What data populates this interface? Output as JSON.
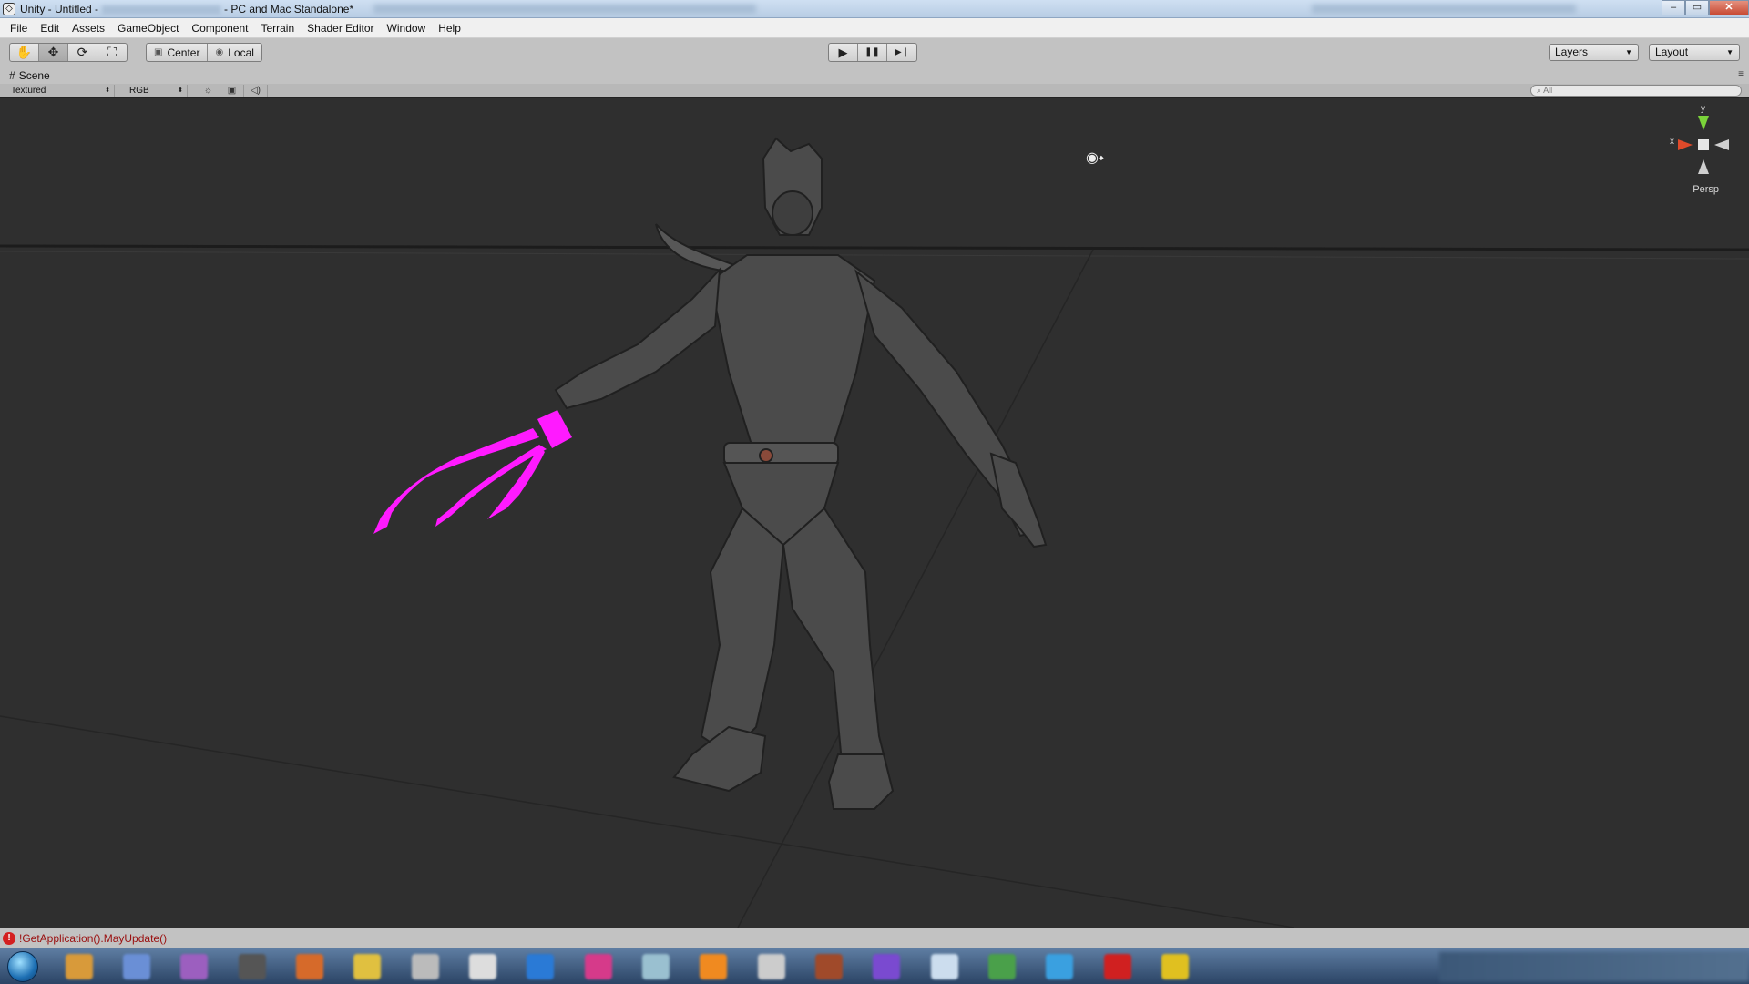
{
  "window": {
    "title_prefix": "Unity - Untitled -",
    "title_suffix": "- PC and Mac Standalone*",
    "controls": {
      "minimize": "‒",
      "maximize": "▭",
      "close": "✕"
    }
  },
  "menu": {
    "items": [
      "File",
      "Edit",
      "Assets",
      "GameObject",
      "Component",
      "Terrain",
      "Shader Editor",
      "Window",
      "Help"
    ]
  },
  "toolbar": {
    "tools": [
      {
        "name": "hand-icon",
        "glyph": "✋"
      },
      {
        "name": "move-icon",
        "glyph": "✥"
      },
      {
        "name": "rotate-icon",
        "glyph": "⟳"
      },
      {
        "name": "scale-icon",
        "glyph": "⛶"
      }
    ],
    "pivot_center": "Center",
    "pivot_local": "Local",
    "play": "▶",
    "pause": "❚❚",
    "step": "▶❙",
    "layers": "Layers",
    "layout": "Layout"
  },
  "scene": {
    "tab_label": "Scene",
    "render_mode": "Textured",
    "color_mode": "RGB",
    "search_placeholder": "All",
    "gizmo_y": "y",
    "gizmo_x": "x",
    "persp_label": "Persp"
  },
  "status": {
    "message": "!GetApplication().MayUpdate()"
  },
  "colors": {
    "viewport_bg": "#2f2f2f",
    "missing_shader": "#ff1aff",
    "model": "#4a4a4a",
    "error": "#d42020"
  }
}
